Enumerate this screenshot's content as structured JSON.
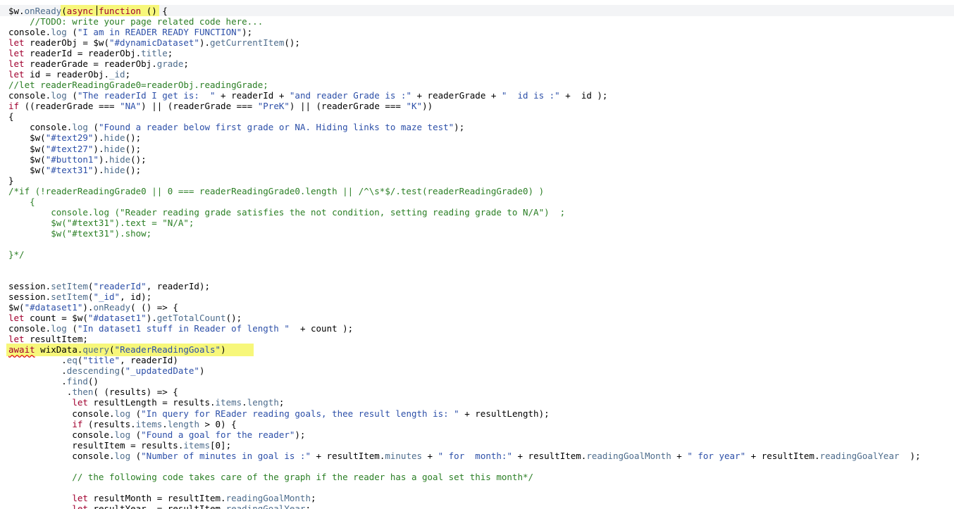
{
  "lines": [
    {
      "tokens": [
        [
          "pl",
          "$w."
        ],
        [
          "fn",
          "onReady"
        ],
        [
          "pl",
          "("
        ],
        [
          "kw",
          "async "
        ],
        [
          "kw",
          "function"
        ],
        [
          "pl",
          " () {"
        ]
      ]
    },
    {
      "tokens": [
        [
          "cm",
          "    //TODO: write your page related code here..."
        ]
      ]
    },
    {
      "tokens": [
        [
          "pl",
          "console."
        ],
        [
          "fn",
          "log"
        ],
        [
          "pl",
          " ("
        ],
        [
          "str",
          "\"I am in READER READY FUNCTION\""
        ],
        [
          "pl",
          ");"
        ]
      ]
    },
    {
      "tokens": [
        [
          "kw",
          "let"
        ],
        [
          "pl",
          " readerObj = $w("
        ],
        [
          "str",
          "\"#dynamicDataset\""
        ],
        [
          "pl",
          ")."
        ],
        [
          "fn",
          "getCurrentItem"
        ],
        [
          "pl",
          "();"
        ]
      ]
    },
    {
      "tokens": [
        [
          "kw",
          "let"
        ],
        [
          "pl",
          " readerId = readerObj."
        ],
        [
          "fn",
          "title"
        ],
        [
          "pl",
          ";"
        ]
      ]
    },
    {
      "tokens": [
        [
          "kw",
          "let"
        ],
        [
          "pl",
          " readerGrade = readerObj."
        ],
        [
          "fn",
          "grade"
        ],
        [
          "pl",
          ";"
        ]
      ]
    },
    {
      "tokens": [
        [
          "kw",
          "let"
        ],
        [
          "pl",
          " id = readerObj."
        ],
        [
          "fn",
          "_id"
        ],
        [
          "pl",
          ";"
        ]
      ]
    },
    {
      "tokens": [
        [
          "cm",
          "//let readerReadingGrade0=readerObj.readingGrade;"
        ]
      ]
    },
    {
      "tokens": [
        [
          "pl",
          "console."
        ],
        [
          "fn",
          "log"
        ],
        [
          "pl",
          " ("
        ],
        [
          "str",
          "\"The readerId I get is:  \""
        ],
        [
          "pl",
          " + readerId + "
        ],
        [
          "str",
          "\"and reader Grade is :\""
        ],
        [
          "pl",
          " + readerGrade + "
        ],
        [
          "str",
          "\"  id is :\""
        ],
        [
          "pl",
          " +  id );"
        ]
      ]
    },
    {
      "tokens": [
        [
          "kw",
          "if"
        ],
        [
          "pl",
          " ((readerGrade === "
        ],
        [
          "str",
          "\"NA\""
        ],
        [
          "pl",
          ") || (readerGrade === "
        ],
        [
          "str",
          "\"PreK\""
        ],
        [
          "pl",
          ") || (readerGrade === "
        ],
        [
          "str",
          "\"K\""
        ],
        [
          "pl",
          "))"
        ]
      ]
    },
    {
      "tokens": [
        [
          "pl",
          "{"
        ]
      ]
    },
    {
      "tokens": [
        [
          "pl",
          "    console."
        ],
        [
          "fn",
          "log"
        ],
        [
          "pl",
          " ("
        ],
        [
          "str",
          "\"Found a reader below first grade or NA. Hiding links to maze test\""
        ],
        [
          "pl",
          ");"
        ]
      ]
    },
    {
      "tokens": [
        [
          "pl",
          "    $w("
        ],
        [
          "str",
          "\"#text29\""
        ],
        [
          "pl",
          ")."
        ],
        [
          "fn",
          "hide"
        ],
        [
          "pl",
          "();"
        ]
      ]
    },
    {
      "tokens": [
        [
          "pl",
          "    $w("
        ],
        [
          "str",
          "\"#text27\""
        ],
        [
          "pl",
          ")."
        ],
        [
          "fn",
          "hide"
        ],
        [
          "pl",
          "();"
        ]
      ]
    },
    {
      "tokens": [
        [
          "pl",
          "    $w("
        ],
        [
          "str",
          "\"#button1\""
        ],
        [
          "pl",
          ")."
        ],
        [
          "fn",
          "hide"
        ],
        [
          "pl",
          "();"
        ]
      ]
    },
    {
      "tokens": [
        [
          "pl",
          "    $w("
        ],
        [
          "str",
          "\"#text31\""
        ],
        [
          "pl",
          ")."
        ],
        [
          "fn",
          "hide"
        ],
        [
          "pl",
          "();"
        ]
      ]
    },
    {
      "tokens": [
        [
          "pl",
          "}"
        ]
      ]
    },
    {
      "tokens": [
        [
          "cm",
          "/*if (!readerReadingGrade0 || 0 === readerReadingGrade0.length || /^\\s*$/.test(readerReadingGrade0) )"
        ]
      ]
    },
    {
      "tokens": [
        [
          "cm",
          "    {"
        ]
      ]
    },
    {
      "tokens": [
        [
          "cm",
          "        console.log (\"Reader reading grade satisfies the not condition, setting reading grade to N/A\")  ;"
        ]
      ]
    },
    {
      "tokens": [
        [
          "cm",
          "        $w(\"#text31\").text = \"N/A\";"
        ]
      ]
    },
    {
      "tokens": [
        [
          "cm",
          "        $w(\"#text31\").show;"
        ]
      ]
    },
    {
      "tokens": [
        [
          "cm",
          ""
        ]
      ]
    },
    {
      "tokens": [
        [
          "cm",
          "}*/"
        ]
      ]
    },
    {
      "tokens": [
        [
          "pl",
          ""
        ]
      ]
    },
    {
      "tokens": [
        [
          "pl",
          ""
        ]
      ]
    },
    {
      "tokens": [
        [
          "pl",
          "session."
        ],
        [
          "fn",
          "setItem"
        ],
        [
          "pl",
          "("
        ],
        [
          "str",
          "\"readerId\""
        ],
        [
          "pl",
          ", readerId);"
        ]
      ]
    },
    {
      "tokens": [
        [
          "pl",
          "session."
        ],
        [
          "fn",
          "setItem"
        ],
        [
          "pl",
          "("
        ],
        [
          "str",
          "\"_id\""
        ],
        [
          "pl",
          ", id);"
        ]
      ]
    },
    {
      "tokens": [
        [
          "pl",
          "$w("
        ],
        [
          "str",
          "\"#dataset1\""
        ],
        [
          "pl",
          ")."
        ],
        [
          "fn",
          "onReady"
        ],
        [
          "pl",
          "( () => {"
        ]
      ]
    },
    {
      "tokens": [
        [
          "kw",
          "let"
        ],
        [
          "pl",
          " count = $w("
        ],
        [
          "str",
          "\"#dataset1\""
        ],
        [
          "pl",
          ")."
        ],
        [
          "fn",
          "getTotalCount"
        ],
        [
          "pl",
          "();"
        ]
      ]
    },
    {
      "tokens": [
        [
          "pl",
          "console."
        ],
        [
          "fn",
          "log"
        ],
        [
          "pl",
          " ("
        ],
        [
          "str",
          "\"In dataset1 stuff in Reader of length \""
        ],
        [
          "pl",
          "  + count );"
        ]
      ]
    },
    {
      "tokens": [
        [
          "kw",
          "let"
        ],
        [
          "pl",
          " resultItem;"
        ]
      ]
    },
    {
      "tokens": [
        [
          "kw",
          "await"
        ],
        [
          "pl",
          " wixData."
        ],
        [
          "fn",
          "query"
        ],
        [
          "pl",
          "("
        ],
        [
          "str",
          "\"ReaderReadingGoals\""
        ],
        [
          "pl",
          ")"
        ]
      ]
    },
    {
      "tokens": [
        [
          "pl",
          "          ."
        ],
        [
          "fn",
          "eq"
        ],
        [
          "pl",
          "("
        ],
        [
          "str",
          "\"title\""
        ],
        [
          "pl",
          ", readerId)"
        ]
      ]
    },
    {
      "tokens": [
        [
          "pl",
          "          ."
        ],
        [
          "fn",
          "descending"
        ],
        [
          "pl",
          "("
        ],
        [
          "str",
          "\"_updatedDate\""
        ],
        [
          "pl",
          ")"
        ]
      ]
    },
    {
      "tokens": [
        [
          "pl",
          "          ."
        ],
        [
          "fn",
          "find"
        ],
        [
          "pl",
          "()"
        ]
      ]
    },
    {
      "tokens": [
        [
          "pl",
          "           ."
        ],
        [
          "fn",
          "then"
        ],
        [
          "pl",
          "( (results) => {"
        ]
      ]
    },
    {
      "tokens": [
        [
          "pl",
          "            "
        ],
        [
          "kw",
          "let"
        ],
        [
          "pl",
          " resultLength = results."
        ],
        [
          "fn",
          "items"
        ],
        [
          "pl",
          "."
        ],
        [
          "fn",
          "length"
        ],
        [
          "pl",
          ";"
        ]
      ]
    },
    {
      "tokens": [
        [
          "pl",
          "            console."
        ],
        [
          "fn",
          "log"
        ],
        [
          "pl",
          " ("
        ],
        [
          "str",
          "\"In query for REader reading goals, thee result length is: \""
        ],
        [
          "pl",
          " + resultLength);"
        ]
      ]
    },
    {
      "tokens": [
        [
          "pl",
          "            "
        ],
        [
          "kw",
          "if"
        ],
        [
          "pl",
          " (results."
        ],
        [
          "fn",
          "items"
        ],
        [
          "pl",
          "."
        ],
        [
          "fn",
          "length"
        ],
        [
          "pl",
          " > 0) {"
        ]
      ]
    },
    {
      "tokens": [
        [
          "pl",
          "            console."
        ],
        [
          "fn",
          "log"
        ],
        [
          "pl",
          " ("
        ],
        [
          "str",
          "\"Found a goal for the reader\""
        ],
        [
          "pl",
          ");"
        ]
      ]
    },
    {
      "tokens": [
        [
          "pl",
          "            resultItem = results."
        ],
        [
          "fn",
          "items"
        ],
        [
          "pl",
          "[0];"
        ]
      ]
    },
    {
      "tokens": [
        [
          "pl",
          "            console."
        ],
        [
          "fn",
          "log"
        ],
        [
          "pl",
          " ("
        ],
        [
          "str",
          "\"Number of minutes in goal is :\""
        ],
        [
          "pl",
          " + resultItem."
        ],
        [
          "fn",
          "minutes"
        ],
        [
          "pl",
          " + "
        ],
        [
          "str",
          "\" for  month:\""
        ],
        [
          "pl",
          " + resultItem."
        ],
        [
          "fn",
          "readingGoalMonth"
        ],
        [
          "pl",
          " + "
        ],
        [
          "str",
          "\" for year\""
        ],
        [
          "pl",
          " + resultItem."
        ],
        [
          "fn",
          "readingGoalYear"
        ],
        [
          "pl",
          "  );"
        ]
      ]
    },
    {
      "tokens": [
        [
          "pl",
          ""
        ]
      ]
    },
    {
      "tokens": [
        [
          "cm",
          "            // the following code takes care of the graph if the reader has a goal set this month*/"
        ]
      ]
    },
    {
      "tokens": [
        [
          "pl",
          ""
        ]
      ]
    },
    {
      "tokens": [
        [
          "pl",
          "            "
        ],
        [
          "kw",
          "let"
        ],
        [
          "pl",
          " resultMonth = resultItem."
        ],
        [
          "fn",
          "readingGoalMonth"
        ],
        [
          "pl",
          ";"
        ]
      ]
    },
    {
      "tokens": [
        [
          "pl",
          "            "
        ],
        [
          "kw",
          "let"
        ],
        [
          "pl",
          " resultYear  = resultItem."
        ],
        [
          "fn",
          "readingGoalYear"
        ],
        [
          "pl",
          ";"
        ]
      ]
    }
  ]
}
